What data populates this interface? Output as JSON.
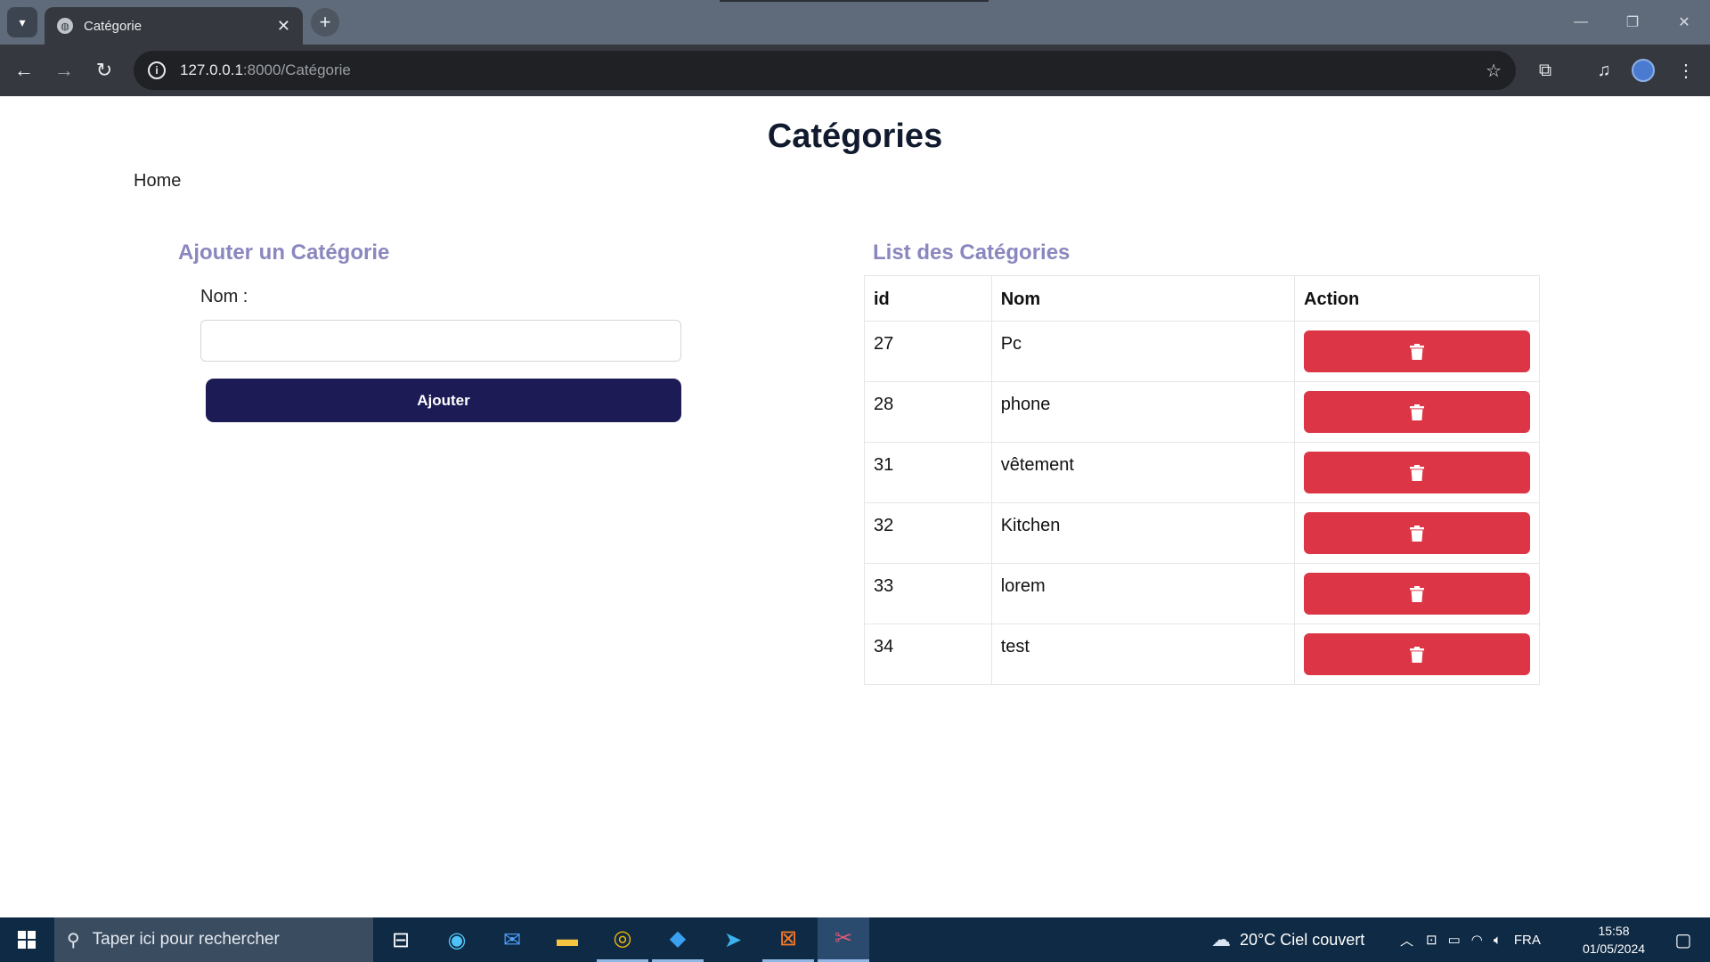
{
  "browser": {
    "tab_title": "Catégorie",
    "url_host": "127.0.0.1",
    "url_path": ":8000/Catégorie"
  },
  "page": {
    "title": "Catégories",
    "home_link": "Home"
  },
  "form": {
    "heading": "Ajouter un Catégorie",
    "nom_label": "Nom :",
    "nom_value": "",
    "submit_label": "Ajouter"
  },
  "list": {
    "heading": "List des Catégories",
    "columns": [
      "id",
      "Nom",
      "Action"
    ],
    "rows": [
      {
        "id": "27",
        "nom": "Pc"
      },
      {
        "id": "28",
        "nom": "phone"
      },
      {
        "id": "31",
        "nom": "vêtement"
      },
      {
        "id": "32",
        "nom": "Kitchen"
      },
      {
        "id": "33",
        "nom": "lorem"
      },
      {
        "id": "34",
        "nom": "test"
      }
    ],
    "delete_icon": "trash-icon",
    "delete_color": "#dc3545"
  },
  "taskbar": {
    "search_placeholder": "Taper ici pour rechercher",
    "weather": "20°C  Ciel couvert",
    "language": "FRA",
    "time": "15:58",
    "date": "01/05/2024"
  },
  "colors": {
    "heading_accent": "#8a87bf",
    "primary_button": "#1c1b55",
    "danger": "#dc3545"
  }
}
